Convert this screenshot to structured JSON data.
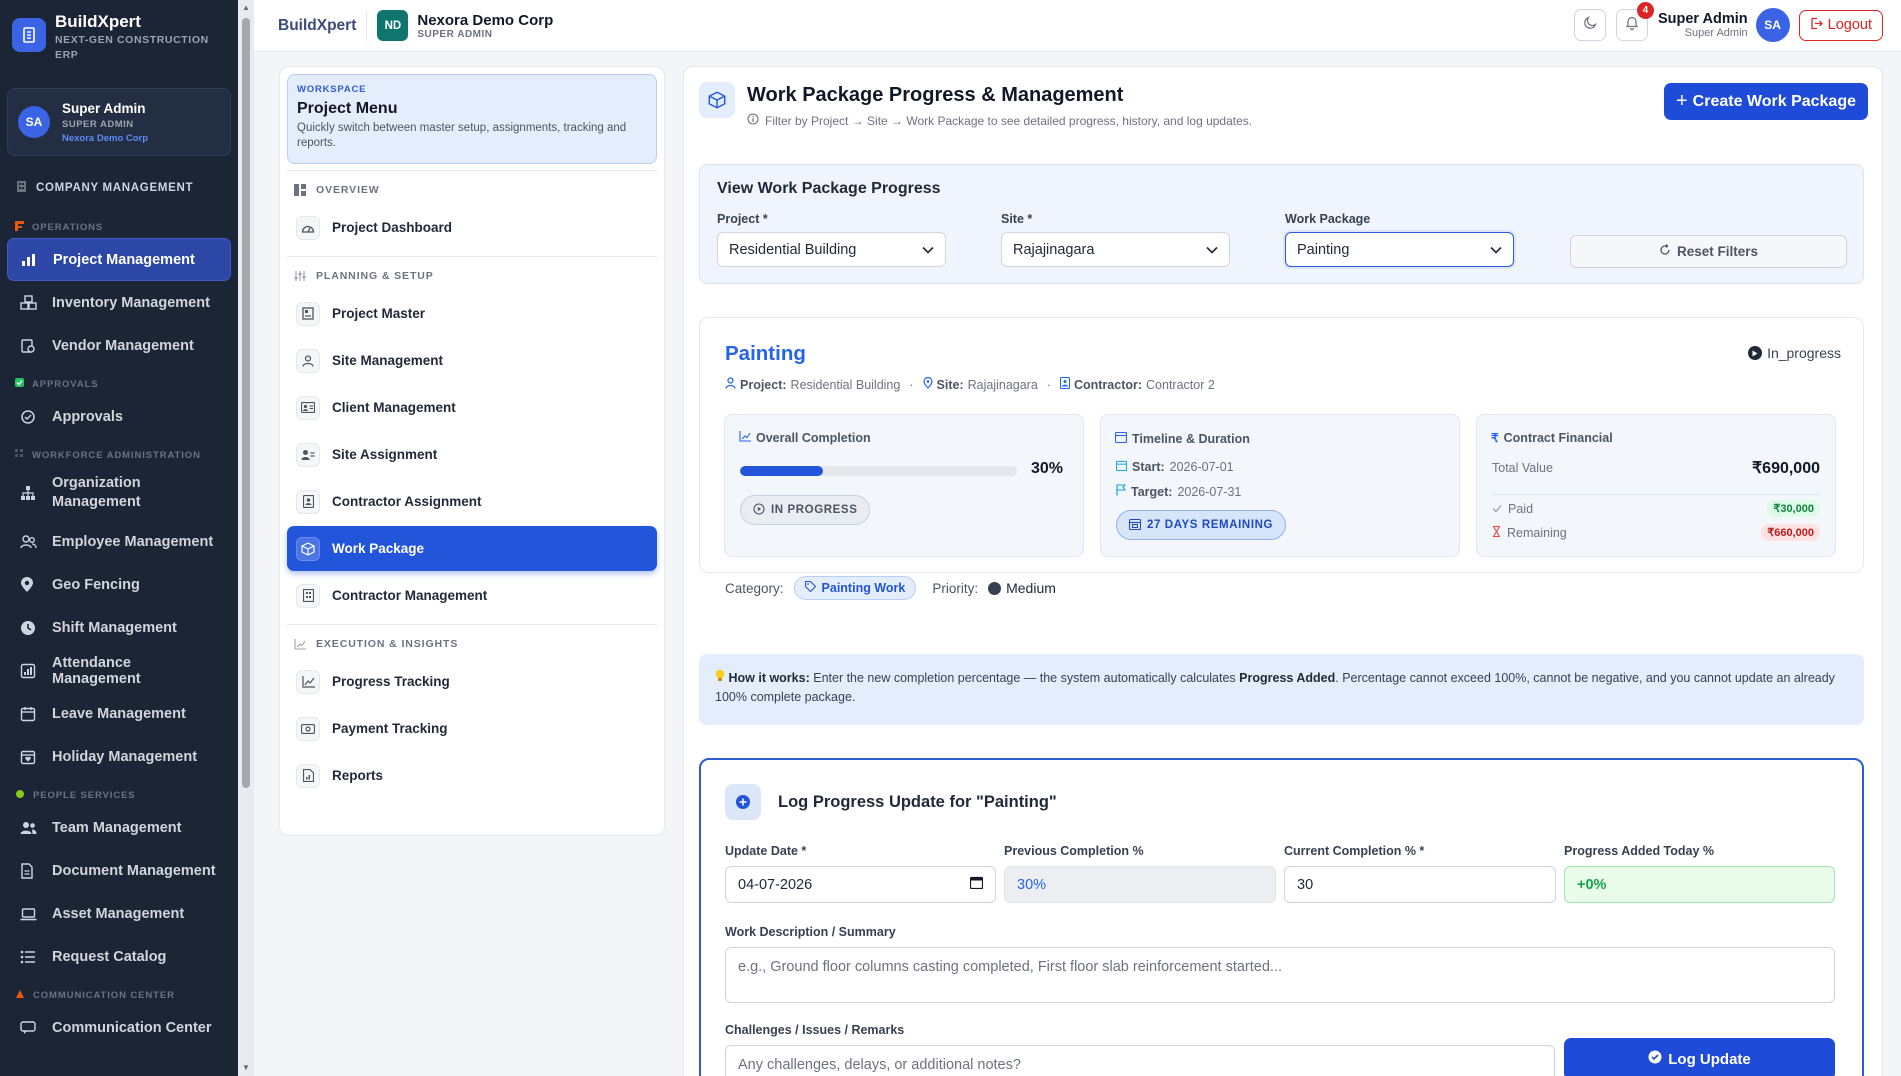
{
  "sidebar": {
    "brand_title": "BuildXpert",
    "brand_sub_1": "NEXT-GEN CONSTRUCTION",
    "brand_sub_2": "ERP",
    "user_name": "Super Admin",
    "user_role": "SUPER ADMIN",
    "user_org": "Nexora Demo Corp",
    "user_initials": "SA",
    "company_management": "COMPANY MANAGEMENT",
    "sections": {
      "operations": "OPERATIONS",
      "approvals": "APPROVALS",
      "workforce": "WORKFORCE ADMINISTRATION",
      "people": "PEOPLE SERVICES",
      "communication": "COMMUNICATION CENTER"
    },
    "items": {
      "project_management": "Project Management",
      "inventory_management": "Inventory Management",
      "vendor_management": "Vendor Management",
      "approvals": "Approvals",
      "organization_management_1": "Organization",
      "organization_management_2": "Management",
      "employee_management": "Employee Management",
      "geo_fencing": "Geo Fencing",
      "shift_management": "Shift Management",
      "attendance_management": "Attendance Management",
      "leave_management": "Leave Management",
      "holiday_management": "Holiday Management",
      "team_management": "Team Management",
      "document_management": "Document Management",
      "asset_management": "Asset Management",
      "request_catalog": "Request Catalog",
      "communication_center": "Communication Center"
    }
  },
  "topbar": {
    "brand": "BuildXpert",
    "org_initials": "ND",
    "org_name": "Nexora Demo Corp",
    "org_role": "SUPER ADMIN",
    "notification_count": "4",
    "user_name": "Super Admin",
    "user_role": "Super Admin",
    "user_initials": "SA",
    "logout_label": "Logout"
  },
  "project_menu": {
    "workspace_label": "WORKSPACE",
    "title": "Project Menu",
    "description": "Quickly switch between master setup, assignments, tracking and reports.",
    "sections": {
      "overview": "OVERVIEW",
      "planning": "PLANNING & SETUP",
      "execution": "EXECUTION & INSIGHTS"
    },
    "items": {
      "project_dashboard": "Project Dashboard",
      "project_master": "Project Master",
      "site_management": "Site Management",
      "client_management": "Client Management",
      "site_assignment": "Site Assignment",
      "contractor_assignment": "Contractor Assignment",
      "work_package": "Work Package",
      "contractor_management": "Contractor Management",
      "progress_tracking": "Progress Tracking",
      "payment_tracking": "Payment Tracking",
      "reports": "Reports"
    }
  },
  "main": {
    "title": "Work Package Progress & Management",
    "subtitle": "Filter by Project → Site → Work Package to see detailed progress, history, and log updates.",
    "create_button": "Create Work Package",
    "filters": {
      "title": "View Work Package Progress",
      "project_label": "Project *",
      "project_value": "Residential Building",
      "site_label": "Site *",
      "site_value": "Rajajinagara",
      "wp_label": "Work Package",
      "wp_value": "Painting",
      "reset_label": "Reset Filters"
    },
    "package": {
      "name": "Painting",
      "status": "In_progress",
      "project_key": "Project:",
      "project_val": "Residential Building",
      "site_key": "Site:",
      "site_val": "Rajajinagara",
      "contractor_key": "Contractor:",
      "contractor_val": "Contractor 2",
      "overall_title": "Overall Completion",
      "completion_pct": 30,
      "completion_text": "30%",
      "status_pill": "IN PROGRESS",
      "timeline_title": "Timeline & Duration",
      "start_key": "Start:",
      "start_val": "2026-07-01",
      "target_key": "Target:",
      "target_val": "2026-07-31",
      "remaining_pill": "27 DAYS REMAINING",
      "financial_title": "Contract Financial",
      "total_label": "Total Value",
      "total_value": "₹690,000",
      "paid_label": "Paid",
      "paid_value": "₹30,000",
      "remaining_label": "Remaining",
      "remaining_value": "₹660,000",
      "category_label": "Category:",
      "category_value": "Painting Work",
      "priority_label": "Priority:",
      "priority_value": "Medium"
    },
    "info": {
      "how_label": "How it works:",
      "text_1": "Enter the new completion percentage — the system automatically calculates",
      "bold_2": "Progress Added",
      "text_3": ". Percentage cannot exceed 100%, cannot be negative, and you cannot update an already 100% complete package."
    },
    "log": {
      "title": "Log Progress Update for \"Painting\"",
      "update_date_label": "Update Date *",
      "update_date_value": "04-07-2026",
      "prev_label": "Previous Completion %",
      "prev_value": "30%",
      "current_label": "Current Completion % *",
      "current_value": "30",
      "added_label": "Progress Added Today %",
      "added_value": "+0%",
      "desc_label": "Work Description / Summary",
      "desc_placeholder": "e.g., Ground floor columns casting completed, First floor slab reinforcement started...",
      "challenges_label": "Challenges / Issues / Remarks",
      "challenges_placeholder": "Any challenges, delays, or additional notes?",
      "submit_label": "Log Update"
    }
  },
  "colors": {
    "sidebar_bg": "#1b2536",
    "accent": "#2355db",
    "active_sidebar": "#2c47a6",
    "danger": "#dc2626",
    "success": "#16a34a"
  }
}
